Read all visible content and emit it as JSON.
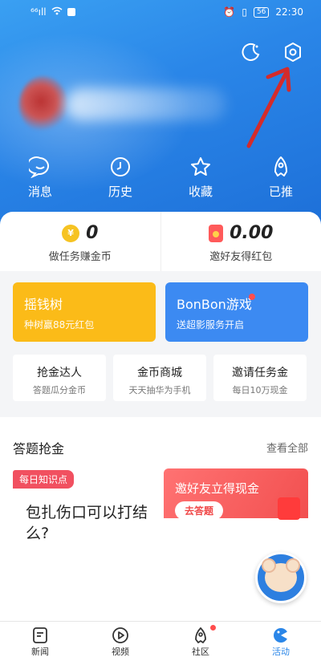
{
  "status": {
    "signal": "⁶⁶ıll",
    "battery": "56",
    "time": "22:30"
  },
  "quick": [
    {
      "icon": "message-icon",
      "label": "消息"
    },
    {
      "icon": "history-icon",
      "label": "历史"
    },
    {
      "icon": "star-icon",
      "label": "收藏"
    },
    {
      "icon": "pushed-icon",
      "label": "已推"
    }
  ],
  "wallet": {
    "coins": {
      "value": "0",
      "label": "做任务赚金币",
      "icon": "¥"
    },
    "redpacket": {
      "value": "0.00",
      "label": "邀好友得红包"
    }
  },
  "promos": [
    {
      "title": "摇钱树",
      "sub": "种树赢88元红包"
    },
    {
      "title": "BonBon游戏",
      "sub": "送超影服务开启"
    }
  ],
  "tasks": [
    {
      "title": "抢金达人",
      "sub": "答题瓜分金币"
    },
    {
      "title": "金币商城",
      "sub": "天天抽华为手机"
    },
    {
      "title": "邀请任务金",
      "sub": "每日10万现金"
    }
  ],
  "quiz": {
    "heading": "答题抢金",
    "more": "查看全部",
    "tag": "每日知识点",
    "question": "包扎伤口可以打结么?",
    "invite_title": "邀好友立得现金",
    "invite_button": "去答题"
  },
  "nav": [
    {
      "icon": "news-icon",
      "label": "新闻"
    },
    {
      "icon": "video-icon",
      "label": "视频"
    },
    {
      "icon": "community-icon",
      "label": "社区"
    },
    {
      "icon": "activity-icon",
      "label": "活动"
    }
  ],
  "colors": {
    "primary": "#2a86e8",
    "yellow": "#fbbb18",
    "red": "#f15060"
  }
}
